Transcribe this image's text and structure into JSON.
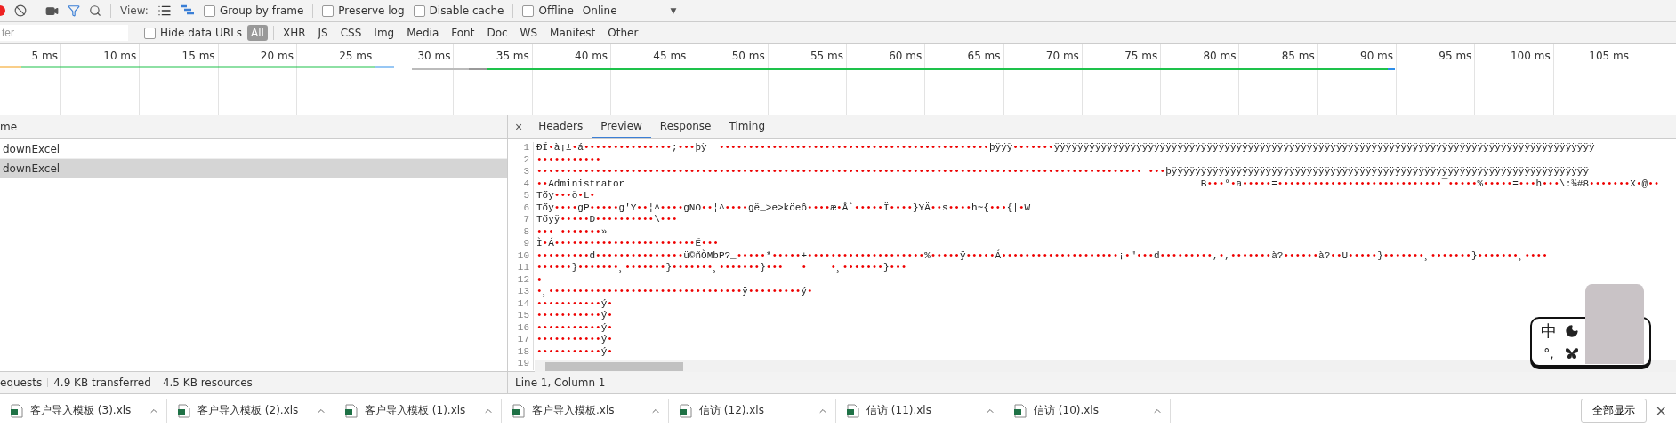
{
  "toolbar": {
    "recording": true,
    "filter_active": true,
    "view_label": "View:",
    "view_buttons": [
      {
        "kind": "list",
        "selected": false
      },
      {
        "kind": "waterfall",
        "selected": true
      }
    ],
    "checkboxes": [
      {
        "label": "Group by frame",
        "checked": false
      },
      {
        "label": "Preserve log",
        "checked": false
      },
      {
        "label": "Disable cache",
        "checked": false
      },
      {
        "label": "Offline",
        "checked": false
      }
    ],
    "throttle": {
      "value": "Online",
      "arrow": "▼"
    }
  },
  "filter_bar": {
    "placeholder": "ter",
    "hide_data_urls": {
      "label": "Hide data URLs",
      "checked": false
    },
    "types": [
      {
        "label": "All",
        "selected": true
      },
      {
        "label": "XHR",
        "selected": false
      },
      {
        "label": "JS",
        "selected": false
      },
      {
        "label": "CSS",
        "selected": false
      },
      {
        "label": "Img",
        "selected": false
      },
      {
        "label": "Media",
        "selected": false
      },
      {
        "label": "Font",
        "selected": false
      },
      {
        "label": "Doc",
        "selected": false
      },
      {
        "label": "WS",
        "selected": false
      },
      {
        "label": "Manifest",
        "selected": false
      },
      {
        "label": "Other",
        "selected": false
      }
    ]
  },
  "timeline": {
    "ticks": [
      "5 ms",
      "10 ms",
      "15 ms",
      "20 ms",
      "25 ms",
      "30 ms",
      "35 ms",
      "40 ms",
      "45 ms",
      "50 ms",
      "55 ms",
      "60 ms",
      "65 ms",
      "70 ms",
      "75 ms",
      "80 ms",
      "85 ms",
      "90 ms",
      "95 ms",
      "100 ms",
      "105 ms"
    ]
  },
  "requests": {
    "column": "me",
    "rows": [
      {
        "name": "downExcel",
        "selected": false
      },
      {
        "name": "downExcel",
        "selected": true
      }
    ]
  },
  "detail": {
    "close": "×",
    "tabs": [
      {
        "label": "Headers",
        "selected": false
      },
      {
        "label": "Preview",
        "selected": true
      },
      {
        "label": "Response",
        "selected": false
      },
      {
        "label": "Timing",
        "selected": false
      }
    ],
    "lines": [
      {
        "number": "1",
        "text": "ÐÏ•à¡±•á•••••••••••••••;•••þÿ  ••••••••••••••••••••••••••••••••••••••••••••••þÿÿÿ•••••••ÿÿÿÿÿÿÿÿÿÿÿÿÿÿÿÿÿÿÿÿÿÿÿÿÿÿÿÿÿÿÿÿÿÿÿÿÿÿÿÿÿÿÿÿÿÿÿÿÿÿÿÿÿÿÿÿÿÿÿÿÿÿÿÿÿÿÿÿÿÿÿÿÿÿÿÿÿÿÿÿÿÿÿÿÿÿÿÿÿÿÿÿ"
      },
      {
        "number": "2",
        "text": "•••••••••••"
      },
      {
        "number": "3",
        "text": "••••••••••••••••••••••••••••••••••••••••••••••••••••••••••••••••••••••••••••••••••••••••••••••••••••••• •••þÿÿÿÿÿÿÿÿÿÿÿÿÿÿÿÿÿÿÿÿÿÿÿÿÿÿÿÿÿÿÿÿÿÿÿÿÿÿÿÿÿÿÿÿÿÿÿÿÿÿÿÿÿÿÿÿÿÿÿÿÿÿÿÿÿÿÿÿÿÿÿ"
      },
      {
        "number": "4",
        "text": "••Administrator                                                                                                  B•••°•a•••••=••••••••••••••••••••••••••••¯•••••%•••••=•••h•••\\:¾#8•••••••X•@••"
      },
      {
        "number": "5",
        "text": "Tőy•••ö•L•"
      },
      {
        "number": "6",
        "text": "Tőy••••gP•••••g'Y••¦^••••gNO••¦^••••gë_>e>köeô••••æ•Å`•••••Ï••••}YÄ••s••••h~{•••{|•W"
      },
      {
        "number": "7",
        "text": "Tőyÿ•••••D••••••••••\\•••"
      },
      {
        "number": "8",
        "text": "••• •••••••»"
      },
      {
        "number": "9",
        "text": "Ì•Á••••••••••••••••••••••••Ë•••"
      },
      {
        "number": "10",
        "text": "•••••••••d•••••••••••••••ü©ñÒMbP?_•••••*•••••+••••••••••••••••••••%•••••ÿ•••••Á••••••••••••••••••••¡•\"•••d•••••••••,•,•••••••à?••••••à?••U•••••}•••••••¸•••••••}•••••••¸••••"
      },
      {
        "number": "11",
        "text": "••••••}•••••••¸•••••••}•••••••¸•••••••}•••   •    •¸•••••••}•••"
      },
      {
        "number": "12",
        "text": "•"
      },
      {
        "number": "13",
        "text": "•¸•••••••••••••••••••••••••••••••••ÿ•••••••••ý•"
      },
      {
        "number": "14",
        "text": "•••••••••••ý•"
      },
      {
        "number": "15",
        "text": "•••••••••••ý•"
      },
      {
        "number": "16",
        "text": "•••••••••••ý•"
      },
      {
        "number": "17",
        "text": "•••••••••••ý•"
      },
      {
        "number": "18",
        "text": "•••••••••••ý•"
      },
      {
        "number": "19"
      }
    ]
  },
  "ime": {
    "mode": "中",
    "punct": "°,"
  },
  "status": {
    "left": [
      "equests",
      "4.9 KB transferred",
      "4.5 KB resources"
    ],
    "right": "Line 1, Column 1"
  },
  "downloads": {
    "items": [
      "客户导入模板 (3).xls",
      "客户导入模板 (2).xls",
      "客户导入模板 (1).xls",
      "客户导入模板.xls",
      "信访 (12).xls",
      "信访 (11).xls",
      "信访 (10).xls"
    ],
    "show_all": "全部显示",
    "close": "×"
  }
}
